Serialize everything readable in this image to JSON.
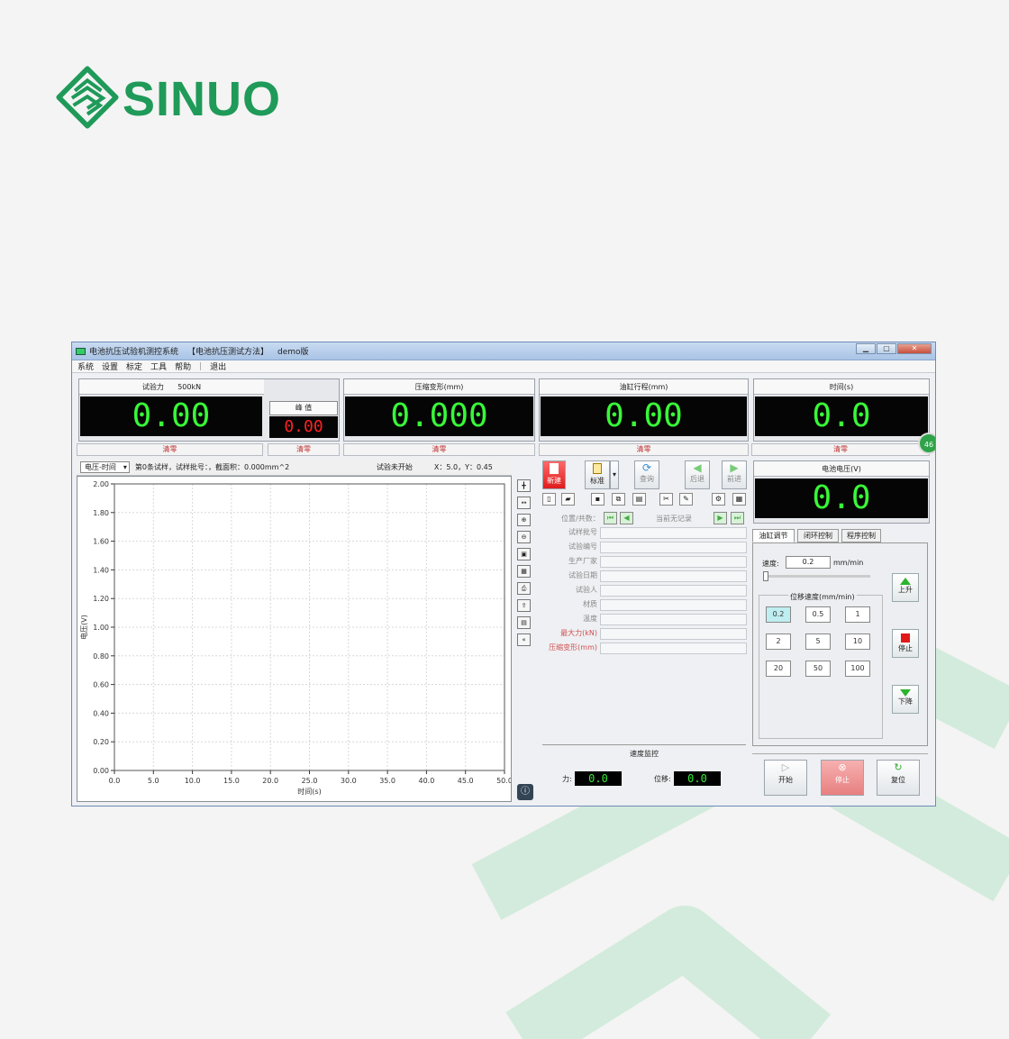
{
  "brand": {
    "name": "SINUO",
    "color": "#1f9a59",
    "watermark_color": "#cfe8d8"
  },
  "window": {
    "icon": "app-icon",
    "title": "电池抗压试验机测控系统",
    "method": "【电池抗压测试方法】",
    "edition": "demo版",
    "controls": [
      "minimize-icon",
      "maximize-icon",
      "close-icon"
    ]
  },
  "menu": [
    "系统",
    "设置",
    "标定",
    "工具",
    "帮助",
    "|",
    "退出"
  ],
  "meters": {
    "force": {
      "label": "试验力",
      "capacity": "500kN",
      "value": "0.00",
      "zero": "清零"
    },
    "peak": {
      "label": "峰 值",
      "value": "0.00",
      "zero": "清零"
    },
    "deform": {
      "label": "压缩变形(mm)",
      "value": "0.000",
      "zero": "清零"
    },
    "stroke": {
      "label": "油缸行程(mm)",
      "value": "0.00",
      "zero": "清零"
    },
    "time": {
      "label": "时间(s)",
      "value": "0.0",
      "zero": "清零"
    },
    "voltage": {
      "label": "电池电压(V)",
      "value": "0.0"
    },
    "badge": "46"
  },
  "chart_header": {
    "selector": "电压-时间",
    "info": "第0条试样，试样批号：，截面积：0.000mm^2",
    "status": "试验未开始",
    "coords": "X：5.0，Y：0.45"
  },
  "chart_data": {
    "type": "line",
    "xlabel": "时间(s)",
    "ylabel": "电压(V)",
    "xlim": [
      0.0,
      50.0
    ],
    "ylim": [
      0.0,
      2.0
    ],
    "xticks": [
      "0.0",
      "5.0",
      "10.0",
      "15.0",
      "20.0",
      "25.0",
      "30.0",
      "35.0",
      "40.0",
      "45.0",
      "50.0"
    ],
    "yticks": [
      "0.00",
      "0.20",
      "0.40",
      "0.60",
      "0.80",
      "1.00",
      "1.20",
      "1.40",
      "1.60",
      "1.80",
      "2.00"
    ],
    "grid": true,
    "series": []
  },
  "toolbar": {
    "record": "新建",
    "standard": "标准",
    "query": "查询",
    "back": "后退",
    "forward": "前进"
  },
  "record_nav": {
    "position_label": "位置/共数：",
    "current": "当前无记录"
  },
  "form_rows": [
    {
      "label": "试样批号",
      "value": "",
      "red": false
    },
    {
      "label": "试验编号",
      "value": "",
      "red": false
    },
    {
      "label": "生产厂家",
      "value": "",
      "red": false
    },
    {
      "label": "试验日期",
      "value": "",
      "red": false
    },
    {
      "label": "试验人",
      "value": "",
      "red": false
    },
    {
      "label": "材质",
      "value": "",
      "red": false
    },
    {
      "label": "温度",
      "value": "",
      "red": false
    },
    {
      "label": "最大力(kN)",
      "value": "",
      "red": true
    },
    {
      "label": "压缩变形(mm)",
      "value": "",
      "red": true
    }
  ],
  "speed_monitor": {
    "title": "速度监控",
    "force_label": "力:",
    "force_value": "0.0",
    "disp_label": "位移:",
    "disp_value": "0.0"
  },
  "control_tabs": [
    "油缸调节",
    "闭环控制",
    "程序控制"
  ],
  "control": {
    "speed_label": "速度:",
    "speed_value": "0.2",
    "speed_unit": "mm/min",
    "preset_title": "位移速度(mm/min)",
    "presets": [
      "0.2",
      "0.5",
      "1",
      "2",
      "5",
      "10",
      "20",
      "50",
      "100"
    ],
    "up": "上升",
    "stop": "停止",
    "down": "下降"
  },
  "bottom_buttons": {
    "start": "开始",
    "stop": "停止",
    "reset": "复位"
  }
}
